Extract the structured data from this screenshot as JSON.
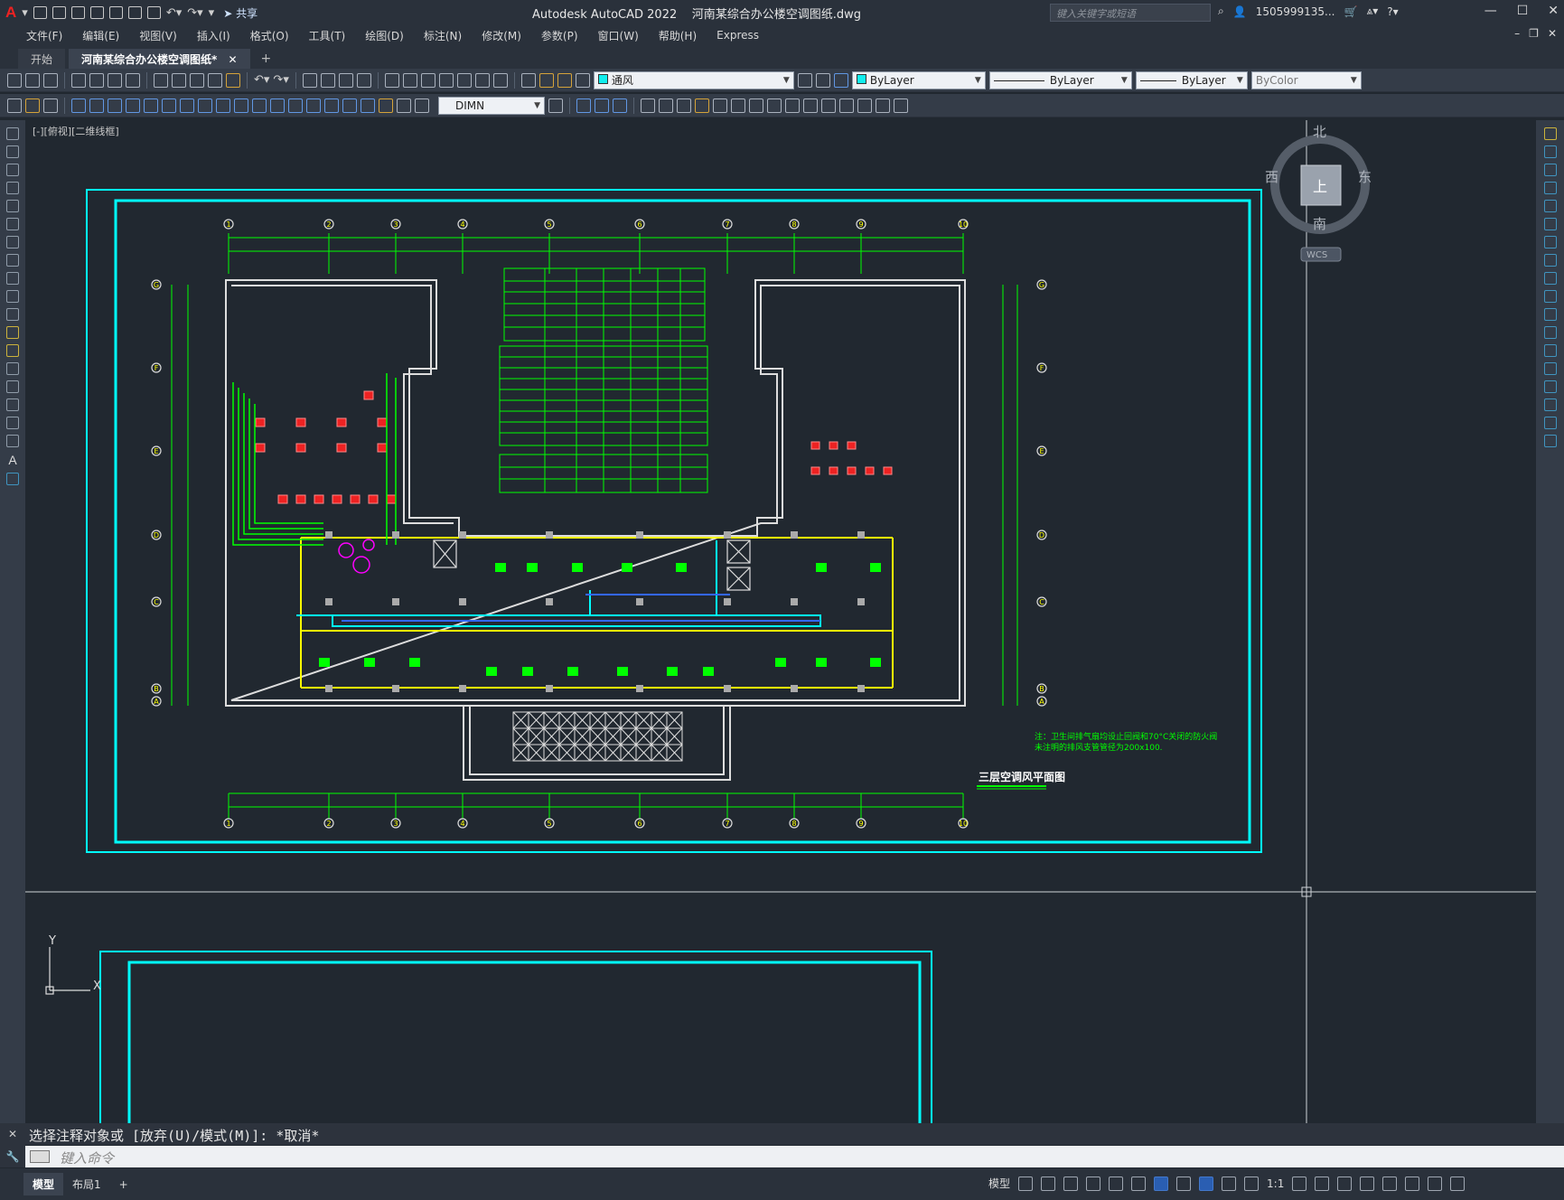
{
  "titlebar": {
    "app_title": "Autodesk AutoCAD 2022",
    "file_name": "河南某综合办公楼空调图纸.dwg",
    "share_label": "共享",
    "search_placeholder": "键入关键字或短语",
    "user": "1505999135...",
    "min": "—",
    "max": "☐",
    "close": "✕"
  },
  "menu": [
    "文件(F)",
    "编辑(E)",
    "视图(V)",
    "插入(I)",
    "格式(O)",
    "工具(T)",
    "绘图(D)",
    "标注(N)",
    "修改(M)",
    "参数(P)",
    "窗口(W)",
    "帮助(H)",
    "Express"
  ],
  "tabs": {
    "start": "开始",
    "active": "河南某综合办公楼空调图纸*",
    "close": "✕",
    "add": "+"
  },
  "toolbar": {
    "layer_value": "通风",
    "color_value": "ByLayer",
    "linetype_value": "ByLayer",
    "lineweight_value": "ByLayer",
    "plotstyle_value": "ByColor",
    "dimstyle_value": "DIMN"
  },
  "viewport": {
    "label": "[-][俯视][二维线框]",
    "viewcube": {
      "north": "北",
      "south": "南",
      "east": "东",
      "west": "西",
      "top": "上",
      "wcs": "WCS"
    },
    "ucs": {
      "x": "X",
      "y": "Y"
    }
  },
  "drawing": {
    "title": "三层空调风平面图",
    "note_line1": "注：卫生间排气扇均设止回阀和70°C关闭的防火阀",
    "note_line2": "未注明的排风支管管径为200x100.",
    "grid_cols": [
      "1",
      "2",
      "3",
      "4",
      "5",
      "6",
      "7",
      "8",
      "9",
      "10"
    ],
    "grid_rows": [
      "G",
      "F",
      "E",
      "D",
      "C",
      "B",
      "A"
    ]
  },
  "command": {
    "history": "选择注释对象或 [放弃(U)/模式(M)]: *取消*",
    "prompt_placeholder": "键入命令"
  },
  "statusbar": {
    "model_tab": "模型",
    "layout_tab": "布局1",
    "add": "+",
    "model_space": "模型",
    "scale": "1:1"
  },
  "colors": {
    "accent_cyan": "#00ffff",
    "accent_green": "#00ff00",
    "accent_yellow": "#ffff00"
  }
}
